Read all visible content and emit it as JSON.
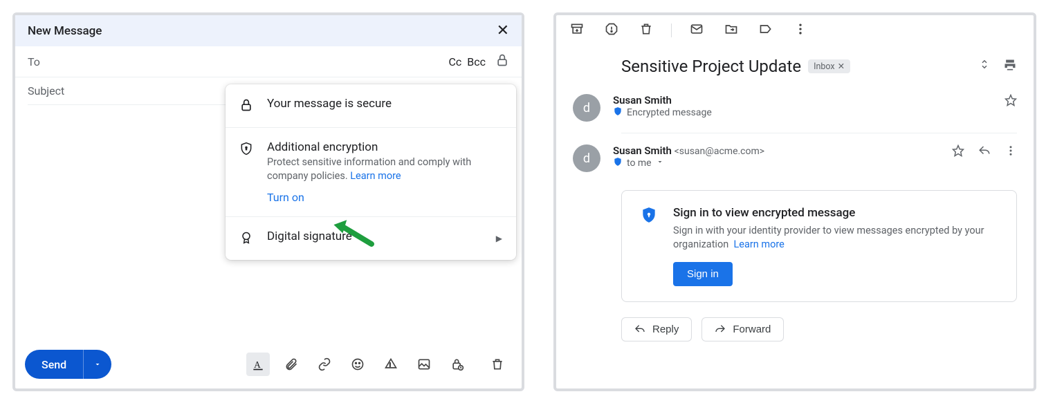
{
  "compose": {
    "title": "New Message",
    "to_label": "To",
    "cc": "Cc",
    "bcc": "Bcc",
    "subject_placeholder": "Subject",
    "send": "Send",
    "popover": {
      "secure_title": "Your message is secure",
      "enc_title": "Additional encryption",
      "enc_desc": "Protect sensitive information and comply with company policies. ",
      "learn_more": "Learn more",
      "turn_on": "Turn on",
      "sig_title": "Digital signature"
    }
  },
  "view": {
    "subject": "Sensitive Project Update",
    "label": "Inbox",
    "sender1_name": "Susan Smith",
    "sender1_sub": "Encrypted message",
    "sender2_name": "Susan Smith",
    "sender2_addr": "<susan@acme.com>",
    "sender2_to": "to me",
    "avatar_letter": "d",
    "enc_title": "Sign in to view encrypted message",
    "enc_desc": "Sign in with your identity provider to view messages encrypted by your organization",
    "learn_more": "Learn  more",
    "sign_in": "Sign in",
    "reply": "Reply",
    "forward": "Forward"
  }
}
